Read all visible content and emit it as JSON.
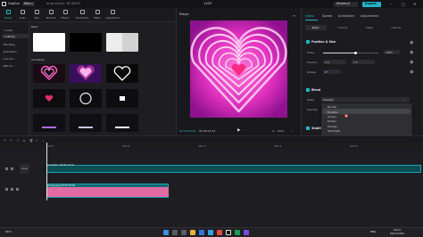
{
  "titlebar": {
    "app_name": "CapCut",
    "menu_label": "Menu",
    "autosave": "Auto saved: 16:38:05",
    "project_title": "1103",
    "shortcut_label": "Shortcut",
    "export_label": "Export",
    "window_controls": [
      "–",
      "□",
      "✕"
    ]
  },
  "toolbar": {
    "items": [
      {
        "label": "Media",
        "icon": "media-icon",
        "active": true
      },
      {
        "label": "Audio",
        "icon": "audio-icon"
      },
      {
        "label": "Text",
        "icon": "text-icon"
      },
      {
        "label": "Stickers",
        "icon": "sticker-icon"
      },
      {
        "label": "Effects",
        "icon": "effects-icon"
      },
      {
        "label": "Transitions",
        "icon": "transitions-icon"
      },
      {
        "label": "Filters",
        "icon": "filters-icon"
      },
      {
        "label": "Adjustment",
        "icon": "adjustment-icon"
      }
    ]
  },
  "leftnav": {
    "items": [
      "• Local",
      "• Library",
      "Trending",
      "Animation",
      "Cut out ...",
      "NIR Co..."
    ]
  },
  "media": {
    "section_basic": "Basic",
    "section_animation": "Animation"
  },
  "player": {
    "title": "Player",
    "timecode_current": "00:00:00:00",
    "timecode_total": "00:00:14:12",
    "controls": [
      "⊡",
      "Ratio",
      "⛶"
    ]
  },
  "right_panel": {
    "tabs": [
      "Video",
      "Speed",
      "Animation",
      "Adjustment"
    ],
    "subtabs": [
      "Basic",
      "Cutout",
      "Mask",
      "Canvas"
    ],
    "position_size": "Position & Size",
    "scale_label": "Scale",
    "scale_value": "178%",
    "scale_fraction": 0.59,
    "position_label": "Position",
    "pos_x": "X  0",
    "pos_y": "Y  0",
    "rotate_label": "Rotate",
    "rotate_value": "0°",
    "blend_label": "Blend",
    "mode_label": "Mode",
    "mode_value": "Overlay",
    "opacity_label": "Opacity",
    "stabilize_label": "Stabilize"
  },
  "blend_modes": {
    "options": [
      "Normal",
      "Brighten",
      "Screen",
      "Darken",
      "Overlay",
      "Hard light",
      "Soft light",
      "Color burn",
      "Linear burn",
      "Color dodge",
      "Multiply"
    ],
    "hovered": "Brighten"
  },
  "timeline": {
    "tools": [
      "↶",
      "↷",
      "⌶",
      "⧉",
      "🗑",
      "◇",
      "⬚"
    ],
    "ruler_marks": [
      "00:00",
      "|00:05",
      "|00:10",
      "|00:15",
      "|00:20"
    ],
    "clip1_label": "animation  00:00:14:12",
    "clip2_label": "Image.jpeg  00:00:05:00",
    "cover_label": "Cover"
  },
  "taskbar": {
    "weather": "18°C",
    "lang": "ENG",
    "time": "16:41",
    "date": "03/11/2023"
  },
  "colors": {
    "accent": "#21b5c7",
    "preview_pink": "#e02fbf",
    "clip_pink": "#e16ba3"
  }
}
